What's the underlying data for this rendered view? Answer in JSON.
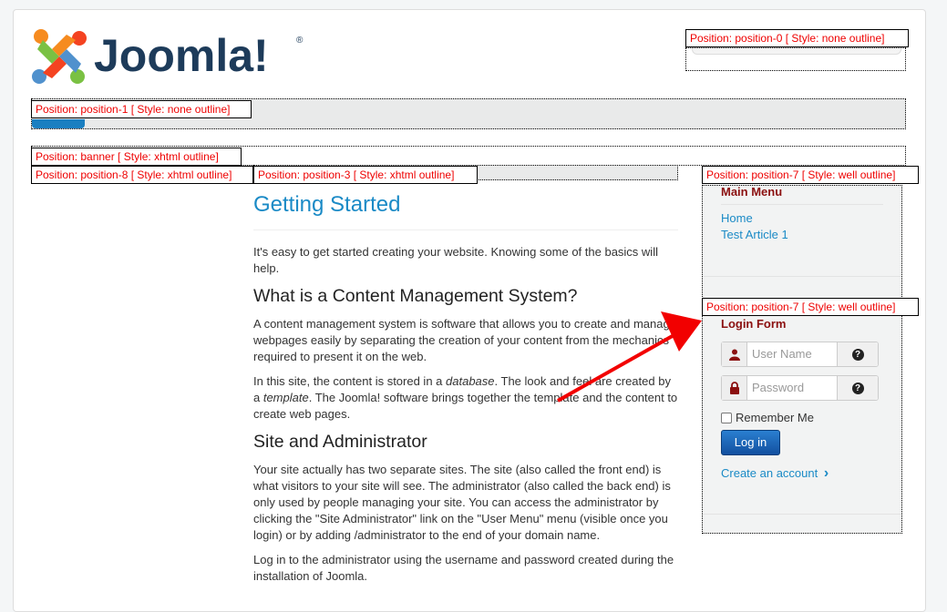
{
  "header": {
    "logo_text": "Joomla!",
    "registered_mark": "®"
  },
  "positions": {
    "position0": "Position: position-0 [ Style: none outline]",
    "position1": "Position: position-1 [ Style: none outline]",
    "banner": "Position: banner [ Style: xhtml outline]",
    "position8": "Position: position-8 [ Style: xhtml outline]",
    "position3": "Position: position-3 [ Style: xhtml outline]",
    "position7a": "Position: position-7 [ Style: well outline]",
    "position7b": "Position: position-7 [ Style: well outline]"
  },
  "article": {
    "title": "Getting Started",
    "intro": "It's easy to get started creating your website. Knowing some of the basics will help.",
    "h_cms": "What is a Content Management System?",
    "p_cms": "A content management system is software that allows you to create and manage webpages easily by separating the creation of your content from the mechanics required to present it on the web.",
    "p_site_a": "In this site, the content is stored in a ",
    "p_site_db": "database",
    "p_site_b": ". The look and feel are created by a ",
    "p_site_tpl": "template",
    "p_site_c": ". The Joomla! software brings together the template and the content to create web pages.",
    "h_admin": "Site and Administrator",
    "p_admin": "Your site actually has two separate sites. The site (also called the front end) is what visitors to your site will see. The administrator (also called the back end) is only used by people managing your site. You can access the administrator by clicking the \"Site Administrator\" link on the \"User Menu\" menu (visible once you login) or by adding /administrator to the end of your domain name.",
    "p_login": "Log in to the administrator using the username and password created during the installation of Joomla."
  },
  "main_menu": {
    "title": "Main Menu",
    "items": [
      "Home",
      "Test Article 1"
    ]
  },
  "login_form": {
    "title": "Login Form",
    "username_placeholder": "User Name",
    "password_placeholder": "Password",
    "help_glyph": "?",
    "remember_label": "Remember Me",
    "login_button": "Log in",
    "create_account": "Create an account",
    "create_account_chevron": "›"
  },
  "colors": {
    "link": "#1a8ac6",
    "module_title": "#8b1010",
    "position_label": "#ee0000",
    "login_button": "#1b5ea8"
  }
}
